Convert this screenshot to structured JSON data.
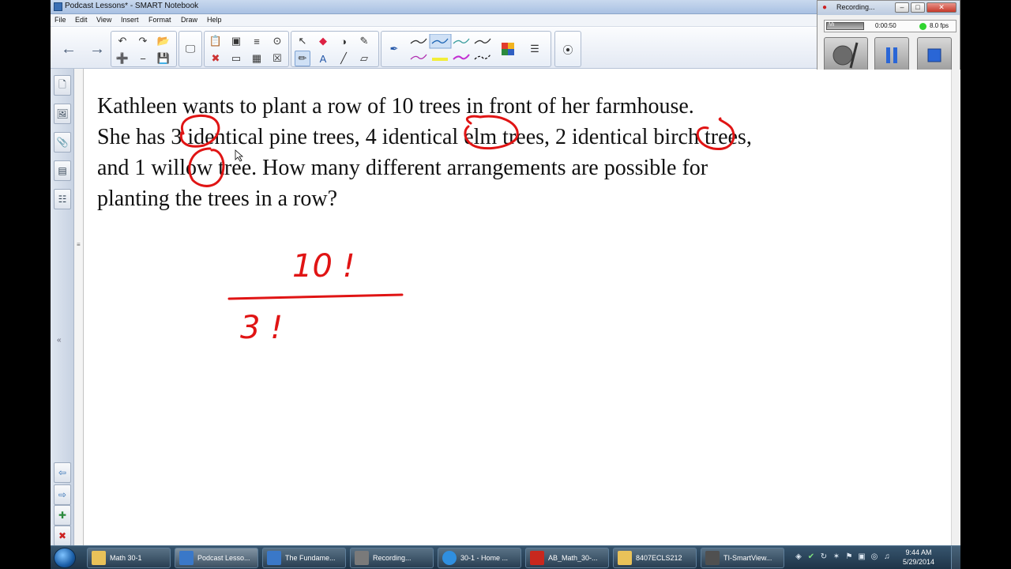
{
  "window": {
    "title": "Podcast Lessons* - SMART Notebook"
  },
  "menu": [
    "File",
    "Edit",
    "View",
    "Insert",
    "Format",
    "Draw",
    "Help"
  ],
  "toolbar": {
    "back_icon": "arrow-left-icon",
    "forward_icon": "arrow-right-icon",
    "colors": {
      "pen_active": "#cfe0f5",
      "accent": "#2f6fb5"
    }
  },
  "recorder": {
    "title": "Recording...",
    "meter_label": "Mi",
    "elapsed": "0:00:50",
    "fps": "8.0 fps",
    "status_color": "#2fd42f"
  },
  "question": {
    "lines": [
      "Kathleen wants to plant a row of 10 trees in front of her farmhouse.",
      "She has 3 identical pine trees, 4 identical elm trees, 2 identical birch trees,",
      "and 1 willow tree.  How many different arrangements are possible for",
      "planting the trees in a row?"
    ]
  },
  "ink": {
    "color": "#e01414",
    "numerator": "10 !",
    "denominator": "3 !"
  },
  "taskbar": {
    "items": [
      {
        "label": "Math 30-1",
        "icon": "folder-icon",
        "color": "#e9c259"
      },
      {
        "label": "Podcast Lesso...",
        "icon": "smart-notebook-icon",
        "color": "#3a78c8",
        "active": true
      },
      {
        "label": "The Fundame...",
        "icon": "smart-notebook-icon",
        "color": "#3a78c8"
      },
      {
        "label": "Recording...",
        "icon": "recorder-icon",
        "color": "#7a7a7a"
      },
      {
        "label": "30-1 - Home ...",
        "icon": "internet-explorer-icon",
        "color": "#2f8fe0"
      },
      {
        "label": "AB_Math_30-...",
        "icon": "pdf-icon",
        "color": "#c8281e"
      },
      {
        "label": "8407ECLS212",
        "icon": "folder-icon",
        "color": "#e9c259"
      },
      {
        "label": "TI-SmartView...",
        "icon": "calculator-icon",
        "color": "#505050"
      }
    ],
    "clock_time": "9:44 AM",
    "clock_date": "5/29/2014"
  }
}
